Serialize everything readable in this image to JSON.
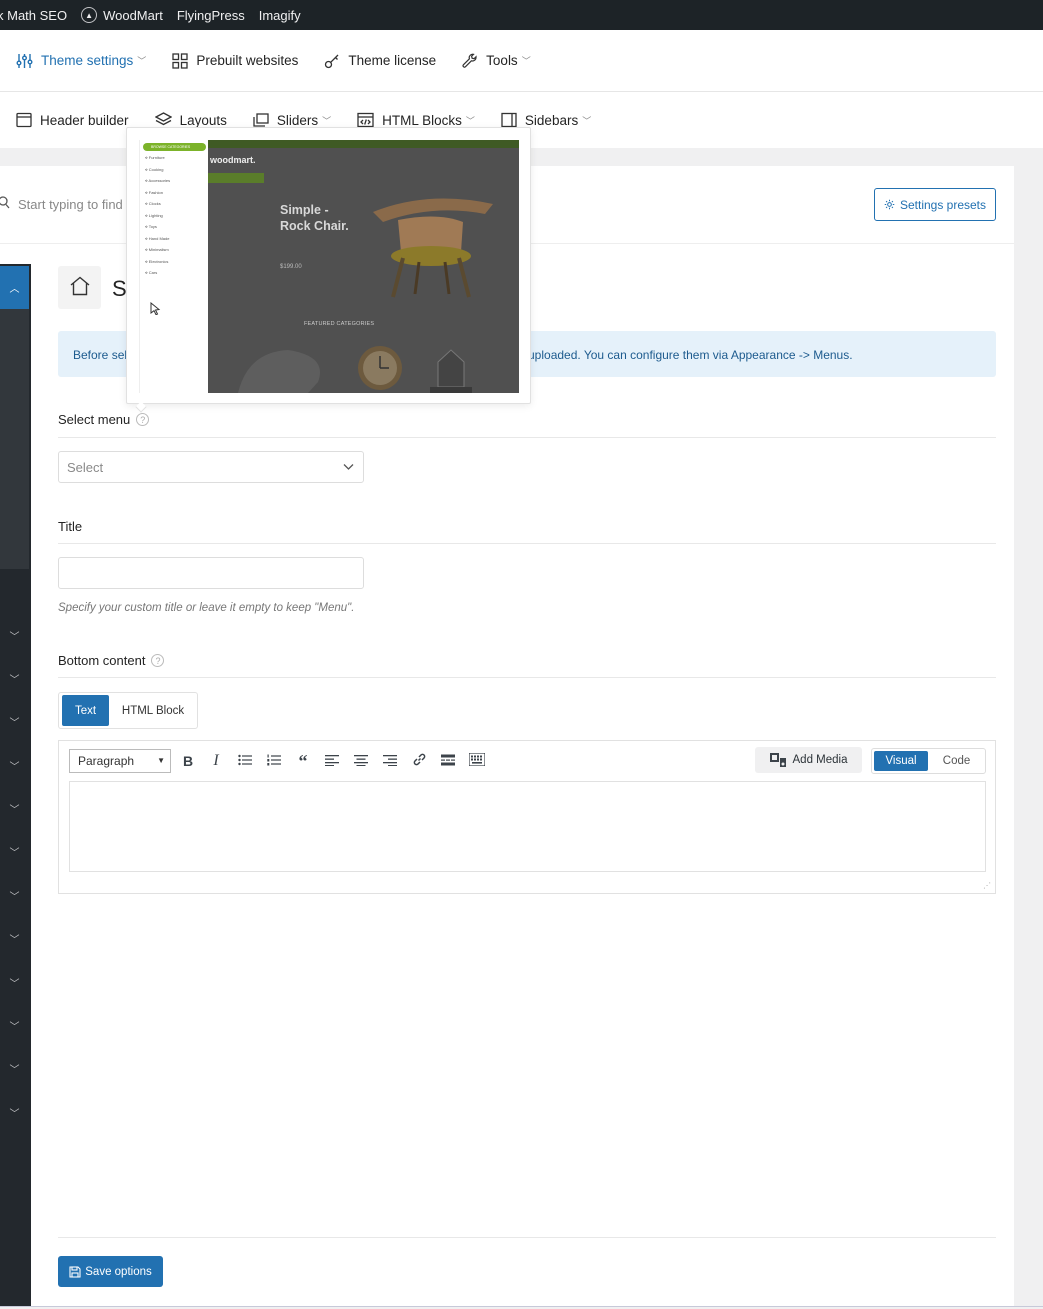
{
  "adminbar": {
    "items": [
      "k Math SEO",
      "WoodMart",
      "FlyingPress",
      "Imagify"
    ]
  },
  "topnav": {
    "theme_settings": "Theme settings",
    "prebuilt_websites": "Prebuilt websites",
    "theme_license": "Theme license",
    "tools": "Tools"
  },
  "subnav": {
    "header_builder": "Header builder",
    "layouts": "Layouts",
    "sliders": "Sliders",
    "html_blocks": "HTML Blocks",
    "sidebars": "Sidebars"
  },
  "search": {
    "placeholder": "Start typing to find"
  },
  "settings_presets_label": "Settings presets",
  "section": {
    "title_partial": "S"
  },
  "notice": {
    "left": "Before sele",
    "right": "uploaded. You can configure them via Appearance -> Menus."
  },
  "fields": {
    "select_menu_label": "Select menu",
    "select_placeholder": "Select",
    "title_label": "Title",
    "title_hint": "Specify your custom title or leave it empty to keep \"Menu\".",
    "bottom_content_label": "Bottom content"
  },
  "tabs": {
    "text": "Text",
    "html_block": "HTML Block"
  },
  "editor": {
    "format": "Paragraph",
    "add_media": "Add Media",
    "visual": "Visual",
    "code": "Code"
  },
  "save_label": "Save options",
  "preview": {
    "browse_categories": "BROWSE CATEGORIES",
    "categories": [
      "Furniture",
      "Cooking",
      "Accessories",
      "Fashion",
      "Clocks",
      "Lighting",
      "Toys",
      "Hand Made",
      "Minimalism",
      "Electronics",
      "Cars"
    ],
    "logo": "woodmart.",
    "hero_title_1": "Simple -",
    "hero_title_2": "Rock Chair.",
    "price": "$199.00",
    "featured": "FEATURED CATEGORIES"
  },
  "colors": {
    "accent": "#2271b1",
    "adminbar": "#1d2327",
    "notice_bg": "#e5f1fa",
    "preview_green": "#7cb32a"
  }
}
